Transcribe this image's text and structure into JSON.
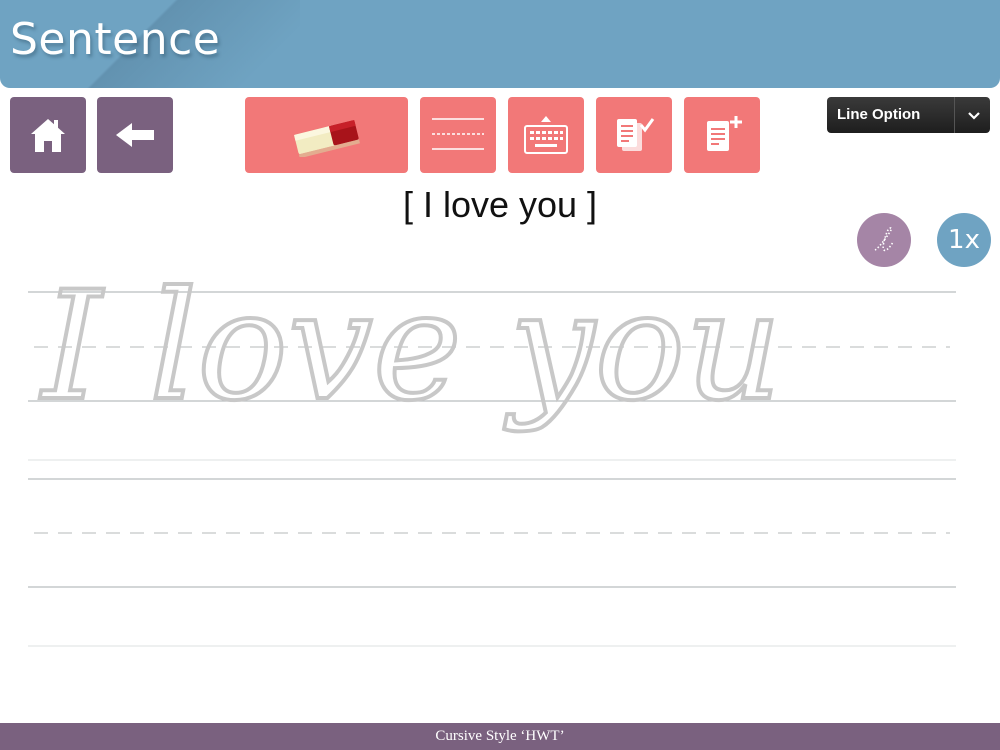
{
  "header": {
    "title": "Sentence"
  },
  "toolbar": {
    "home_icon": "home-icon",
    "back_icon": "back-arrow-icon",
    "eraser_icon": "eraser-icon",
    "lines_icon": "guide-lines-icon",
    "keyboard_icon": "keyboard-icon",
    "check_icon": "document-check-icon",
    "add_icon": "document-add-icon"
  },
  "line_option": {
    "label": "Line Option"
  },
  "sentence": {
    "text": "[ I love you ]"
  },
  "trace": {
    "text": "I love you",
    "style_icon": "cursive-letter-icon",
    "speed": "1x"
  },
  "footer": {
    "prefix": "Cursive Style",
    "quote_open": "‘",
    "style_name": "HWT",
    "quote_close": "’"
  },
  "colors": {
    "header": "#6fa3c2",
    "purple": "#7a617f",
    "pink": "#f27878",
    "lavender": "#a585a6"
  }
}
